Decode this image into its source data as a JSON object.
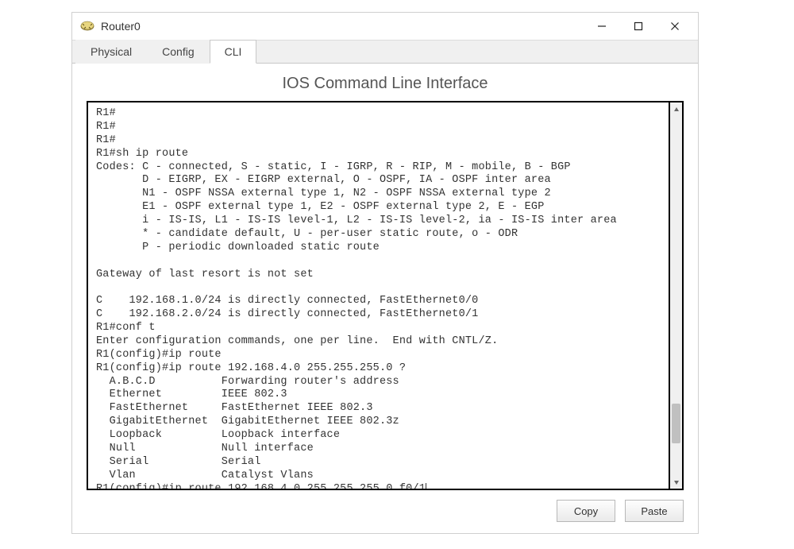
{
  "window": {
    "title": "Router0"
  },
  "tabs": {
    "physical": "Physical",
    "config": "Config",
    "cli": "CLI",
    "active": "cli"
  },
  "cli": {
    "heading": "IOS Command Line Interface",
    "terminal_text": "R1#\nR1#\nR1#\nR1#sh ip route\nCodes: C - connected, S - static, I - IGRP, R - RIP, M - mobile, B - BGP\n       D - EIGRP, EX - EIGRP external, O - OSPF, IA - OSPF inter area\n       N1 - OSPF NSSA external type 1, N2 - OSPF NSSA external type 2\n       E1 - OSPF external type 1, E2 - OSPF external type 2, E - EGP\n       i - IS-IS, L1 - IS-IS level-1, L2 - IS-IS level-2, ia - IS-IS inter area\n       * - candidate default, U - per-user static route, o - ODR\n       P - periodic downloaded static route\n\nGateway of last resort is not set\n\nC    192.168.1.0/24 is directly connected, FastEthernet0/0\nC    192.168.2.0/24 is directly connected, FastEthernet0/1\nR1#conf t\nEnter configuration commands, one per line.  End with CNTL/Z.\nR1(config)#ip route\nR1(config)#ip route 192.168.4.0 255.255.255.0 ?\n  A.B.C.D          Forwarding router's address\n  Ethernet         IEEE 802.3\n  FastEthernet     FastEthernet IEEE 802.3\n  GigabitEthernet  GigabitEthernet IEEE 802.3z\n  Loopback         Loopback interface\n  Null             Null interface\n  Serial           Serial\n  Vlan             Catalyst Vlans\nR1(config)#ip route 192.168.4.0 255.255.255.0 f0/1"
  },
  "buttons": {
    "copy": "Copy",
    "paste": "Paste"
  }
}
